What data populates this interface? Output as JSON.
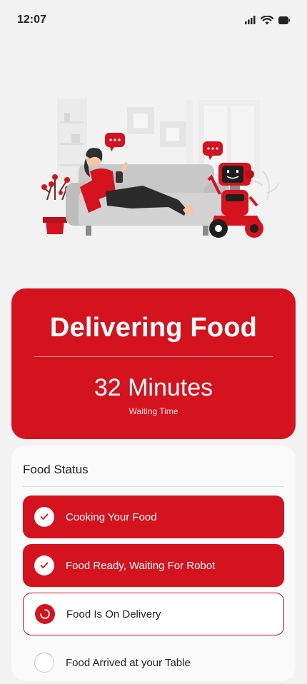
{
  "status_bar": {
    "time": "12:07"
  },
  "hero": {
    "title": "Delivering Food",
    "time_value": "32 Minutes",
    "time_caption": "Waiting Time"
  },
  "status_panel": {
    "title": "Food Status",
    "steps": [
      {
        "label": "Cooking Your Food",
        "state": "done"
      },
      {
        "label": "Food Ready, Waiting For Robot",
        "state": "done"
      },
      {
        "label": "Food Is On Delivery",
        "state": "active"
      },
      {
        "label": "Food Arrived at your Table",
        "state": "pending"
      }
    ]
  },
  "colors": {
    "accent": "#d4131f",
    "background": "#f2f2f2"
  }
}
